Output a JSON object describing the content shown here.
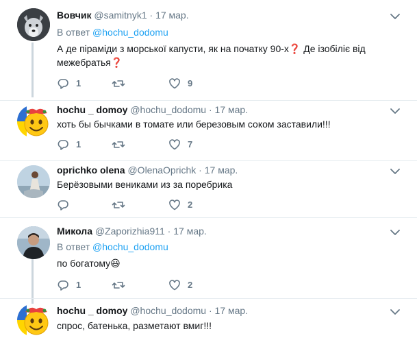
{
  "tweets": [
    {
      "name": "Вовчик",
      "handle": "@samitnyk1",
      "separator": "·",
      "date": "17 мар.",
      "reply_prefix": "В ответ",
      "reply_to": "@hochu_dodomu",
      "text": "А де піраміди з морської капусти, як на початку 90-х❓ Де ізобіліє від межебратья❓",
      "replies": "1",
      "retweets": "",
      "likes": "9",
      "avatar_icon": "wolf-avatar"
    },
    {
      "name": "hochu _ domoy",
      "handle": "@hochu_dodomu",
      "separator": "·",
      "date": "17 мар.",
      "text": "хоть бы бычками  в томате или березовым соком заставили!!!",
      "replies": "1",
      "retweets": "",
      "likes": "7",
      "avatar_icon": "smiley-avatar"
    },
    {
      "name": "oprichko olena",
      "handle": "@OlenaOprichk",
      "separator": "·",
      "date": "17 мар.",
      "text": "Берёзовыми вениками из за поребрика",
      "replies": "",
      "retweets": "",
      "likes": "2",
      "avatar_icon": "photo-avatar"
    },
    {
      "name": "Микола",
      "handle": "@Zaporizhia911",
      "separator": "·",
      "date": "17 мар.",
      "reply_prefix": "В ответ",
      "reply_to": "@hochu_dodomu",
      "text": "по богатому😃",
      "replies": "1",
      "retweets": "",
      "likes": "2",
      "avatar_icon": "photo-avatar"
    },
    {
      "name": "hochu _ domoy",
      "handle": "@hochu_dodomu",
      "separator": "·",
      "date": "17 мар.",
      "text": "спрос, батенька, разметают вмиг!!!",
      "avatar_icon": "smiley-avatar"
    }
  ],
  "colors": {
    "accent": "#1da1f2",
    "muted": "#657786",
    "divider": "#e6ecf0",
    "thread_line": "#ccd6dd"
  }
}
